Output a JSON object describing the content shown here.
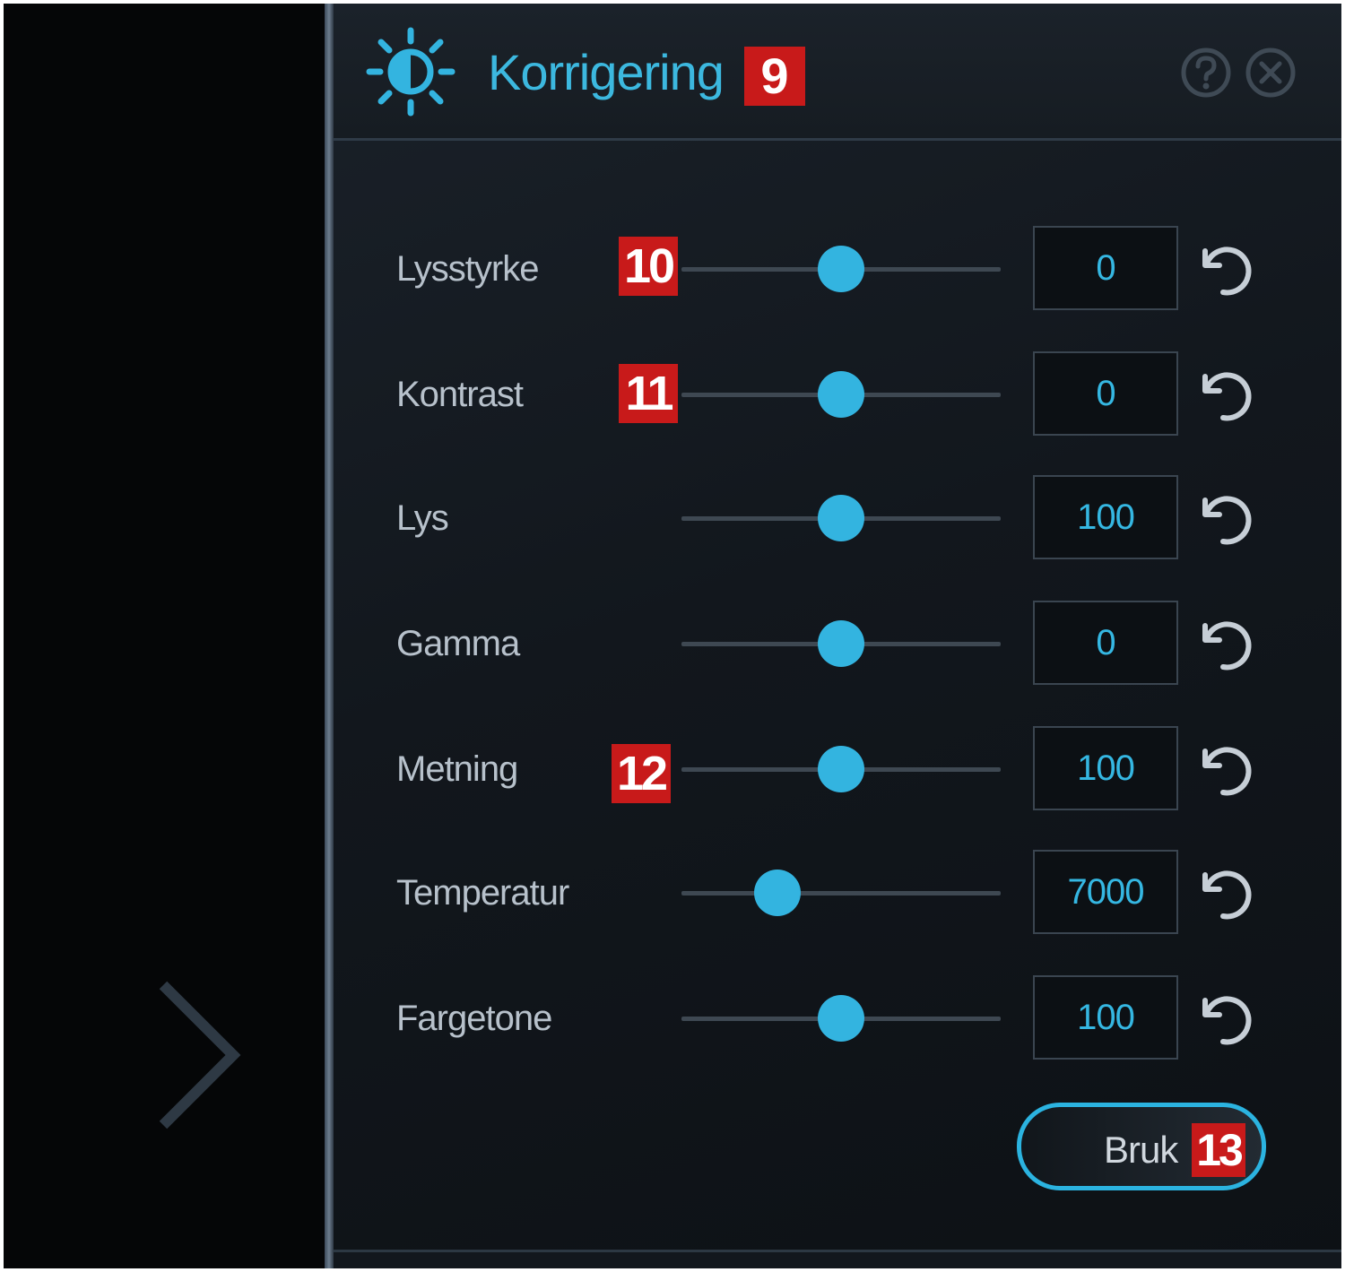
{
  "panel": {
    "title": "Korrigering",
    "accent_color": "#33b4e0",
    "header_buttons": [
      {
        "name": "help",
        "icon": "question-circle-icon"
      },
      {
        "name": "close",
        "icon": "close-circle-icon"
      }
    ]
  },
  "callouts": {
    "title": "9",
    "brightness": "10",
    "contrast": "11",
    "saturation": "12",
    "apply": "13"
  },
  "sliders": [
    {
      "label": "Lysstyrke",
      "value": "0",
      "position": 0.5
    },
    {
      "label": "Kontrast",
      "value": "0",
      "position": 0.5
    },
    {
      "label": "Lys",
      "value": "100",
      "position": 0.5
    },
    {
      "label": "Gamma",
      "value": "0",
      "position": 0.5
    },
    {
      "label": "Metning",
      "value": "100",
      "position": 0.5
    },
    {
      "label": "Temperatur",
      "value": "7000",
      "position": 0.3
    },
    {
      "label": "Fargetone",
      "value": "100",
      "position": 0.5
    }
  ],
  "apply_button": {
    "label": "Bruk"
  },
  "sidebar": {
    "expand_icon": "chevron-right-icon"
  }
}
